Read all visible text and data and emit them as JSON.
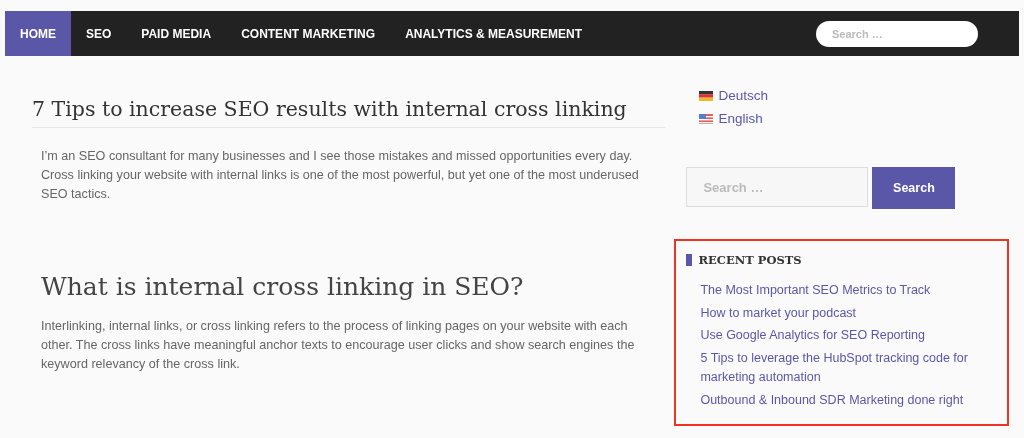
{
  "nav": {
    "items": [
      {
        "label": "HOME",
        "selected": true
      },
      {
        "label": "SEO",
        "selected": false
      },
      {
        "label": "PAID MEDIA",
        "selected": false
      },
      {
        "label": "CONTENT MARKETING",
        "selected": false
      },
      {
        "label": "ANALYTICS & MEASUREMENT",
        "selected": false
      }
    ],
    "search": {
      "placeholder": "Search …"
    }
  },
  "article": {
    "title": "7 Tips to increase SEO results with internal cross linking",
    "intro": "I’m an SEO consultant for many businesses and I see those mistakes and missed opportunities every day. Cross linking your website with internal links is one of the most powerful, but yet one of the most underused SEO tactics.",
    "heading": "What is internal cross linking in SEO?",
    "body": "Interlinking, internal links, or cross linking refers to the process of linking pages on your website with each other. The cross links have meaningful anchor texts to encourage user clicks and show search engines the keyword relevancy of the cross link."
  },
  "sidebar": {
    "languages": [
      {
        "kind": "de",
        "label": "Deutsch"
      },
      {
        "kind": "us",
        "label": "English"
      }
    ],
    "search": {
      "placeholder": "Search …",
      "button": "Search"
    },
    "recent_posts": {
      "title": "RECENT POSTS",
      "highlighted": true,
      "posts": [
        "The Most Important SEO Metrics to Track",
        "How to market your podcast",
        "Use Google Analytics for SEO Reporting",
        "5 Tips to leverage the HubSpot tracking code for marketing automation",
        "Outbound & Inbound SDR Marketing done right"
      ]
    }
  }
}
